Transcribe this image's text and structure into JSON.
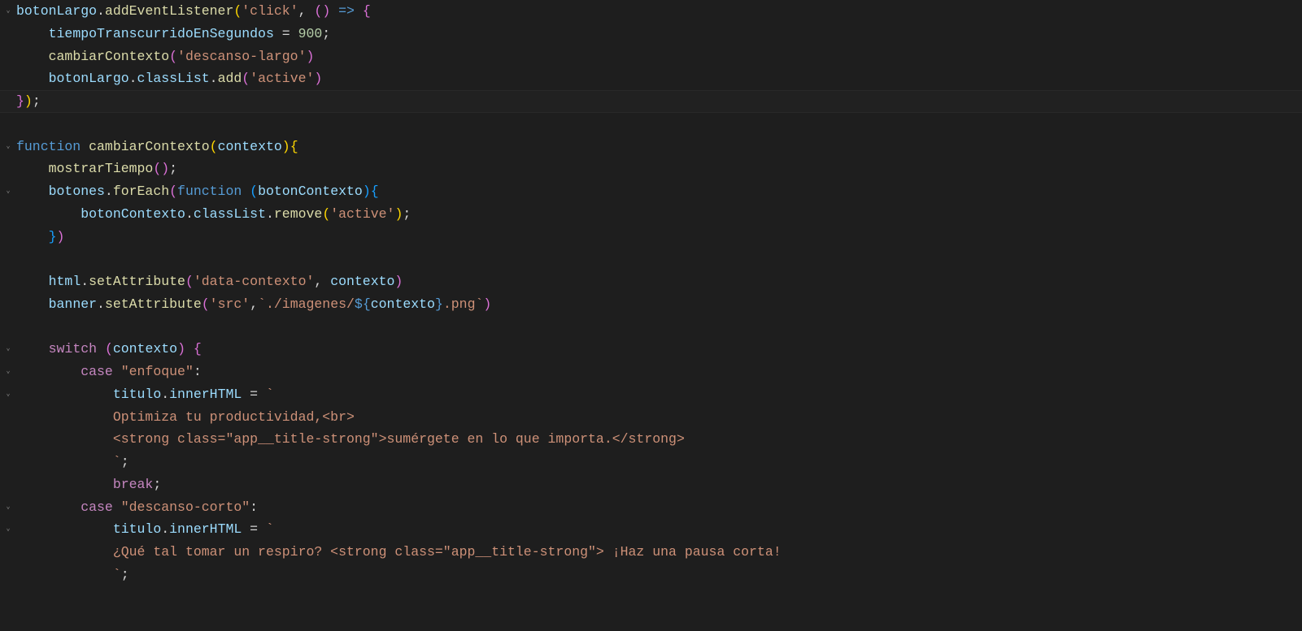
{
  "lines": [
    {
      "fold": true,
      "tokens": [
        {
          "c": "t-var",
          "t": "botonLargo"
        },
        {
          "c": "t-punc",
          "t": "."
        },
        {
          "c": "t-fn",
          "t": "addEventListener"
        },
        {
          "c": "t-par1",
          "t": "("
        },
        {
          "c": "t-str",
          "t": "'click'"
        },
        {
          "c": "t-punc",
          "t": ", "
        },
        {
          "c": "t-par2",
          "t": "("
        },
        {
          "c": "t-par2",
          "t": ")"
        },
        {
          "c": "t-punc",
          "t": " "
        },
        {
          "c": "t-arrow",
          "t": "=>"
        },
        {
          "c": "t-punc",
          "t": " "
        },
        {
          "c": "t-par2",
          "t": "{"
        }
      ]
    },
    {
      "indent": 1,
      "tokens": [
        {
          "c": "t-var",
          "t": "tiempoTranscurridoEnSegundos"
        },
        {
          "c": "t-punc",
          "t": " = "
        },
        {
          "c": "t-num",
          "t": "900"
        },
        {
          "c": "t-punc",
          "t": ";"
        }
      ]
    },
    {
      "indent": 1,
      "tokens": [
        {
          "c": "t-fn",
          "t": "cambiarContexto"
        },
        {
          "c": "t-par2",
          "t": "("
        },
        {
          "c": "t-str",
          "t": "'descanso-largo'"
        },
        {
          "c": "t-par2",
          "t": ")"
        }
      ]
    },
    {
      "indent": 1,
      "tokens": [
        {
          "c": "t-var",
          "t": "botonLargo"
        },
        {
          "c": "t-punc",
          "t": "."
        },
        {
          "c": "t-prop",
          "t": "classList"
        },
        {
          "c": "t-punc",
          "t": "."
        },
        {
          "c": "t-fn",
          "t": "add"
        },
        {
          "c": "t-par2",
          "t": "("
        },
        {
          "c": "t-str",
          "t": "'active'"
        },
        {
          "c": "t-par2",
          "t": ")"
        }
      ]
    },
    {
      "highlight": true,
      "tokens": [
        {
          "c": "t-par2",
          "t": "}"
        },
        {
          "c": "t-par1",
          "t": ")"
        },
        {
          "c": "t-punc",
          "t": ";"
        }
      ]
    },
    {
      "blank": true
    },
    {
      "fold": true,
      "tokens": [
        {
          "c": "t-kw",
          "t": "function"
        },
        {
          "c": "t-punc",
          "t": " "
        },
        {
          "c": "t-fn",
          "t": "cambiarContexto"
        },
        {
          "c": "t-par1",
          "t": "("
        },
        {
          "c": "t-var",
          "t": "contexto"
        },
        {
          "c": "t-par1",
          "t": ")"
        },
        {
          "c": "t-par1",
          "t": "{"
        }
      ]
    },
    {
      "indent": 1,
      "tokens": [
        {
          "c": "t-fn",
          "t": "mostrarTiempo"
        },
        {
          "c": "t-par2",
          "t": "("
        },
        {
          "c": "t-par2",
          "t": ")"
        },
        {
          "c": "t-punc",
          "t": ";"
        }
      ]
    },
    {
      "fold": true,
      "indent": 1,
      "tokens": [
        {
          "c": "t-var",
          "t": "botones"
        },
        {
          "c": "t-punc",
          "t": "."
        },
        {
          "c": "t-fn",
          "t": "forEach"
        },
        {
          "c": "t-par2",
          "t": "("
        },
        {
          "c": "t-kw",
          "t": "function"
        },
        {
          "c": "t-punc",
          "t": " "
        },
        {
          "c": "t-par3",
          "t": "("
        },
        {
          "c": "t-var",
          "t": "botonContexto"
        },
        {
          "c": "t-par3",
          "t": ")"
        },
        {
          "c": "t-par3",
          "t": "{"
        }
      ]
    },
    {
      "indent": 2,
      "tokens": [
        {
          "c": "t-var",
          "t": "botonContexto"
        },
        {
          "c": "t-punc",
          "t": "."
        },
        {
          "c": "t-prop",
          "t": "classList"
        },
        {
          "c": "t-punc",
          "t": "."
        },
        {
          "c": "t-fn",
          "t": "remove"
        },
        {
          "c": "t-par1",
          "t": "("
        },
        {
          "c": "t-str",
          "t": "'active'"
        },
        {
          "c": "t-par1",
          "t": ")"
        },
        {
          "c": "t-punc",
          "t": ";"
        }
      ]
    },
    {
      "indent": 1,
      "tokens": [
        {
          "c": "t-par3",
          "t": "}"
        },
        {
          "c": "t-par2",
          "t": ")"
        }
      ]
    },
    {
      "blank": true
    },
    {
      "indent": 1,
      "tokens": [
        {
          "c": "t-var",
          "t": "html"
        },
        {
          "c": "t-punc",
          "t": "."
        },
        {
          "c": "t-fn",
          "t": "setAttribute"
        },
        {
          "c": "t-par2",
          "t": "("
        },
        {
          "c": "t-str",
          "t": "'data-contexto'"
        },
        {
          "c": "t-punc",
          "t": ", "
        },
        {
          "c": "t-var",
          "t": "contexto"
        },
        {
          "c": "t-par2",
          "t": ")"
        }
      ]
    },
    {
      "indent": 1,
      "tokens": [
        {
          "c": "t-var",
          "t": "banner"
        },
        {
          "c": "t-punc",
          "t": "."
        },
        {
          "c": "t-fn",
          "t": "setAttribute"
        },
        {
          "c": "t-par2",
          "t": "("
        },
        {
          "c": "t-str",
          "t": "'src'"
        },
        {
          "c": "t-punc",
          "t": ","
        },
        {
          "c": "t-str",
          "t": "`./imagenes/"
        },
        {
          "c": "t-arrow",
          "t": "${"
        },
        {
          "c": "t-var",
          "t": "contexto"
        },
        {
          "c": "t-arrow",
          "t": "}"
        },
        {
          "c": "t-str",
          "t": ".png`"
        },
        {
          "c": "t-par2",
          "t": ")"
        }
      ]
    },
    {
      "blank": true
    },
    {
      "fold": true,
      "indent": 1,
      "tokens": [
        {
          "c": "t-kwc",
          "t": "switch"
        },
        {
          "c": "t-punc",
          "t": " "
        },
        {
          "c": "t-par2",
          "t": "("
        },
        {
          "c": "t-var",
          "t": "contexto"
        },
        {
          "c": "t-par2",
          "t": ")"
        },
        {
          "c": "t-punc",
          "t": " "
        },
        {
          "c": "t-par2",
          "t": "{"
        }
      ]
    },
    {
      "fold": true,
      "indent": 2,
      "tokens": [
        {
          "c": "t-kwc",
          "t": "case"
        },
        {
          "c": "t-punc",
          "t": " "
        },
        {
          "c": "t-str",
          "t": "\"enfoque\""
        },
        {
          "c": "t-punc",
          "t": ":"
        }
      ]
    },
    {
      "fold": true,
      "indent": 3,
      "tokens": [
        {
          "c": "t-var",
          "t": "titulo"
        },
        {
          "c": "t-punc",
          "t": "."
        },
        {
          "c": "t-prop",
          "t": "innerHTML"
        },
        {
          "c": "t-punc",
          "t": " = "
        },
        {
          "c": "t-str",
          "t": "`"
        }
      ]
    },
    {
      "indent": 3,
      "tokens": [
        {
          "c": "t-str",
          "t": "Optimiza tu productividad,<br>"
        }
      ]
    },
    {
      "indent": 3,
      "tokens": [
        {
          "c": "t-str",
          "t": "<strong class=\"app__title-strong\">sumérgete en lo que importa.</strong>"
        }
      ]
    },
    {
      "indent": 3,
      "tokens": [
        {
          "c": "t-str",
          "t": "`"
        },
        {
          "c": "t-punc",
          "t": ";"
        }
      ]
    },
    {
      "indent": 3,
      "tokens": [
        {
          "c": "t-kwc",
          "t": "break"
        },
        {
          "c": "t-punc",
          "t": ";"
        }
      ]
    },
    {
      "fold": true,
      "indent": 2,
      "tokens": [
        {
          "c": "t-kwc",
          "t": "case"
        },
        {
          "c": "t-punc",
          "t": " "
        },
        {
          "c": "t-str",
          "t": "\"descanso-corto\""
        },
        {
          "c": "t-punc",
          "t": ":"
        }
      ]
    },
    {
      "fold": true,
      "indent": 3,
      "tokens": [
        {
          "c": "t-var",
          "t": "titulo"
        },
        {
          "c": "t-punc",
          "t": "."
        },
        {
          "c": "t-prop",
          "t": "innerHTML"
        },
        {
          "c": "t-punc",
          "t": " = "
        },
        {
          "c": "t-str",
          "t": "`"
        }
      ]
    },
    {
      "indent": 3,
      "tokens": [
        {
          "c": "t-str",
          "t": "¿Qué tal tomar un respiro? <strong class=\"app__title-strong\"> ¡Haz una pausa corta!"
        }
      ]
    },
    {
      "indent": 3,
      "tokens": [
        {
          "c": "t-str",
          "t": "`"
        },
        {
          "c": "t-punc",
          "t": ";"
        }
      ]
    },
    {
      "blank": true
    }
  ],
  "indentUnit": "    ",
  "chevron": "⌄"
}
